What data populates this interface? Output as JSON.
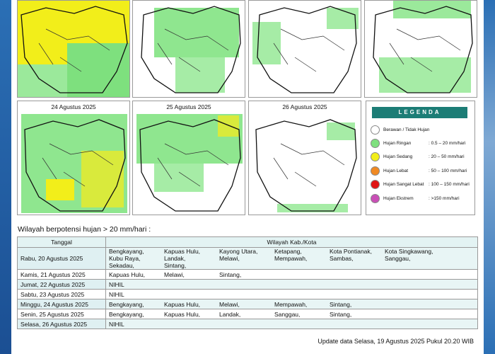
{
  "maps": [
    {
      "id": "map-top-1",
      "title": ""
    },
    {
      "id": "map-top-2",
      "title": ""
    },
    {
      "id": "map-top-3",
      "title": ""
    },
    {
      "id": "map-top-4",
      "title": ""
    },
    {
      "id": "map-24",
      "title": "24 Agustus 2025"
    },
    {
      "id": "map-25",
      "title": "25 Agustus 2025"
    },
    {
      "id": "map-26",
      "title": "26 Agustus 2025"
    }
  ],
  "legend": {
    "title": "LEGENDA",
    "items": [
      {
        "label": "Berawan / Tidak Hujan",
        "range": "",
        "color": "#ffffff"
      },
      {
        "label": "Hujan Ringan",
        "range": ": 0.5 – 20 mm/hari",
        "color": "#7ee07e"
      },
      {
        "label": "Hujan Sedang",
        "range": ": 20 – 50 mm/hari",
        "color": "#f2ee1a"
      },
      {
        "label": "Hujan Lebat",
        "range": ": 50 – 100 mm/hari",
        "color": "#f08a24"
      },
      {
        "label": "Hujan Sangat Lebat",
        "range": ": 100 – 150 mm/hari",
        "color": "#e01414"
      },
      {
        "label": "Hujan Ekstrem",
        "range": ": >150 mm/hari",
        "color": "#c94fb6"
      }
    ]
  },
  "heading": "Wilayah berpotensi hujan > 20 mm/hari :",
  "table": {
    "col_date": "Tanggal",
    "col_areas": "Wilayah Kab./Kota",
    "rows": [
      {
        "date": "Rabu, 20 Agustus 2025",
        "areas": [
          "Bengkayang,",
          "Kapuas Hulu,",
          "Kayong Utara,",
          "Ketapang,",
          "Kota Pontianak,",
          "Kota Singkawang,",
          "Kubu Raya,",
          "Landak,",
          "Melawi,",
          "Mempawah,",
          "Sambas,",
          "Sanggau,",
          "Sekadau,",
          "Sintang,"
        ]
      },
      {
        "date": "Kamis, 21 Agustus 2025",
        "areas": [
          "Kapuas Hulu,",
          "Melawi,",
          "Sintang,"
        ]
      },
      {
        "date": "Jumat, 22 Agustus 2025",
        "areas": [
          "NIHIL"
        ]
      },
      {
        "date": "Sabtu, 23 Agustus 2025",
        "areas": [
          "NIHIL"
        ]
      },
      {
        "date": "Minggu, 24 Agustus 2025",
        "areas": [
          "Bengkayang,",
          "Kapuas Hulu,",
          "Melawi,",
          "Mempawah,",
          "Sintang,"
        ]
      },
      {
        "date": "Senin, 25 Agustus 2025",
        "areas": [
          "Bengkayang,",
          "Kapuas Hulu,",
          "Landak,",
          "Sanggau,",
          "Sintang,"
        ]
      },
      {
        "date": "Selasa, 26 Agustus 2025",
        "areas": [
          "NIHIL"
        ]
      }
    ]
  },
  "update_text": "Update data Selasa, 19 Agustus 2025 Pukul 20.20 WIB"
}
